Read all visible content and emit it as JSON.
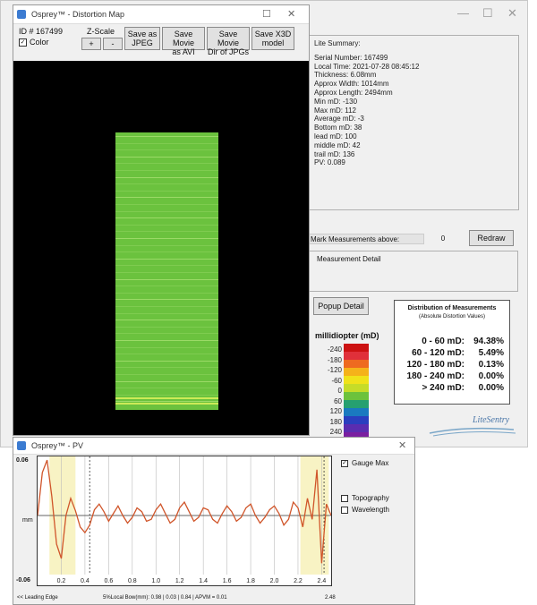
{
  "map_window": {
    "title": "Osprey™ - Distortion Map",
    "id_label": "ID # 167499",
    "color_checkbox": "Color",
    "zscale_label": "Z-Scale",
    "zscale_plus": "+",
    "zscale_minus": "-",
    "buttons": [
      {
        "l1": "Save as",
        "l2": "JPEG"
      },
      {
        "l1": "Save Movie",
        "l2": "as AVI"
      },
      {
        "l1": "Save Movie",
        "l2": "Dir of JPGs"
      },
      {
        "l1": "Save X3D",
        "l2": "model"
      }
    ]
  },
  "summary": {
    "heading": "Lite Summary:",
    "lines": [
      "Serial Number: 167499",
      "Local Time: 2021-07-28 08:45:12",
      "Thickness: 6.08mm",
      "Approx Width: 1014mm",
      "Approx Length: 2494mm",
      "Min mD: -130",
      "Max mD: 112",
      "Average mD: -3",
      "Bottom mD: 38",
      "lead mD: 100",
      "middle mD: 42",
      "trail mD: 136",
      "PV: 0.089"
    ],
    "mark_label": "Mark Measurements above:",
    "mark_value": "0",
    "redraw_button": "Redraw",
    "measurement_detail": "Measurement Detail",
    "popup_button": "Popup Detail"
  },
  "distribution": {
    "title": "Distribution of Measurements",
    "subtitle": "(Absolute Distortion Values)",
    "rows": [
      {
        "range": "0 - 60 mD:",
        "pct": "94.38%"
      },
      {
        "range": "60 - 120 mD:",
        "pct": "5.49%"
      },
      {
        "range": "120 - 180 mD:",
        "pct": "0.13%"
      },
      {
        "range": "180 - 240 mD:",
        "pct": "0.00%"
      },
      {
        "range": "> 240 mD:",
        "pct": "0.00%"
      }
    ]
  },
  "legend": {
    "title": "millidiopter (mD)",
    "ticks": [
      "-240",
      "-180",
      "-120",
      "-60",
      "0",
      "60",
      "120",
      "180",
      "240"
    ],
    "colors": [
      "#cc1111",
      "#e0303a",
      "#ee6a20",
      "#f5b21a",
      "#f0e21a",
      "#c6dc28",
      "#6cc23c",
      "#26a070",
      "#1a7ac0",
      "#2a3fbf",
      "#5a2db0",
      "#7a1fa0"
    ]
  },
  "brand": "LiteSentry",
  "pv_window": {
    "title": "Osprey™ - PV",
    "y_top": "0.06",
    "y_mid": "mm",
    "y_bottom": "-0.06",
    "gauge_max": "Gauge Max",
    "topography": "Topography",
    "wavelength": "Wavelength",
    "status_left": "<< Leading Edge",
    "status_mid": "5%Local Bow(mm): 0.98 | 0.03 | 0.84 | APVM = 0.01",
    "status_right": "2.48"
  },
  "chart_data": {
    "type": "line",
    "xlabel": "",
    "ylabel": "mm",
    "xlim": [
      0,
      2.48
    ],
    "ylim": [
      -0.06,
      0.06
    ],
    "x_ticks": [
      "0.2",
      "0.4",
      "0.6",
      "0.8",
      "1.0",
      "1.2",
      "1.4",
      "1.6",
      "1.8",
      "2.0",
      "2.2",
      "2.4"
    ],
    "series": [
      {
        "name": "",
        "x": [
          0.0,
          0.04,
          0.08,
          0.12,
          0.16,
          0.2,
          0.24,
          0.28,
          0.32,
          0.36,
          0.4,
          0.44,
          0.48,
          0.52,
          0.56,
          0.6,
          0.64,
          0.68,
          0.72,
          0.76,
          0.8,
          0.84,
          0.88,
          0.92,
          0.96,
          1.0,
          1.04,
          1.08,
          1.12,
          1.16,
          1.2,
          1.24,
          1.28,
          1.32,
          1.36,
          1.4,
          1.44,
          1.48,
          1.52,
          1.56,
          1.6,
          1.64,
          1.68,
          1.72,
          1.76,
          1.8,
          1.84,
          1.88,
          1.92,
          1.96,
          2.0,
          2.04,
          2.08,
          2.12,
          2.16,
          2.2,
          2.24,
          2.28,
          2.32,
          2.36,
          2.4,
          2.44,
          2.48
        ],
        "values": [
          0.0,
          0.045,
          0.058,
          0.02,
          -0.03,
          -0.045,
          0.0,
          0.018,
          0.005,
          -0.012,
          -0.018,
          -0.01,
          0.006,
          0.012,
          0.004,
          -0.006,
          0.002,
          0.01,
          0.0,
          -0.008,
          -0.002,
          0.008,
          0.004,
          -0.006,
          -0.004,
          0.006,
          0.012,
          0.002,
          -0.008,
          -0.004,
          0.008,
          0.014,
          0.004,
          -0.006,
          -0.002,
          0.008,
          0.006,
          -0.004,
          -0.008,
          0.002,
          0.01,
          0.004,
          -0.006,
          -0.002,
          0.008,
          0.012,
          0.0,
          -0.008,
          -0.002,
          0.006,
          0.01,
          0.002,
          -0.01,
          -0.004,
          0.014,
          0.008,
          -0.012,
          0.018,
          -0.004,
          0.048,
          -0.05,
          0.012,
          0.0
        ]
      }
    ],
    "shaded_regions": [
      [
        0.1,
        0.32
      ],
      [
        2.22,
        2.46
      ]
    ],
    "dashed_markers": [
      0.44,
      2.42
    ],
    "grid": true
  }
}
